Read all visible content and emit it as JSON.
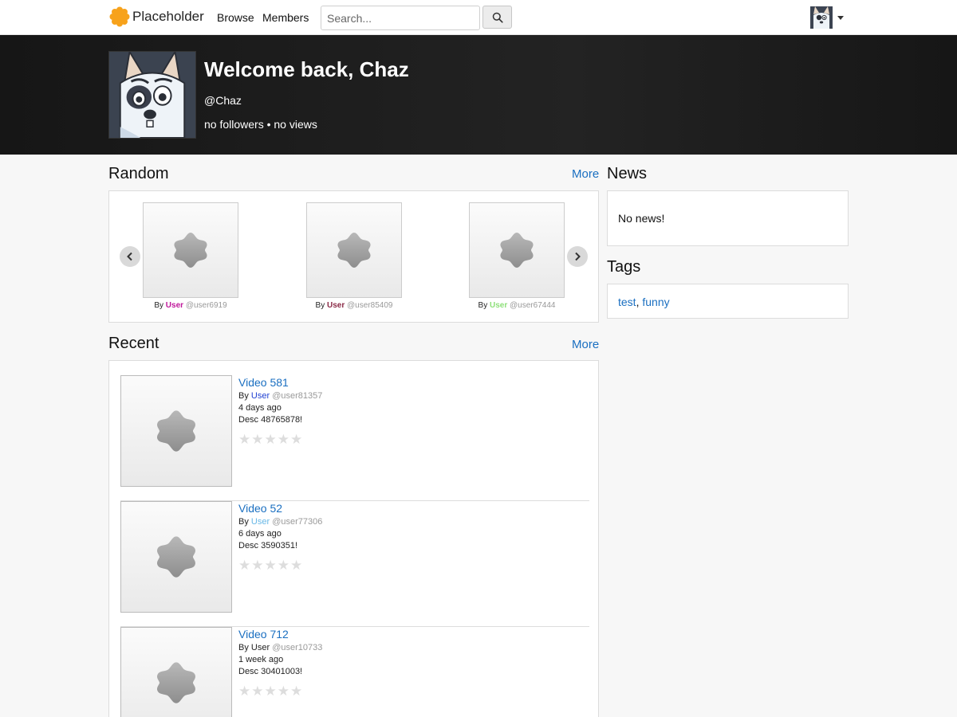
{
  "nav": {
    "brand": "Placeholder",
    "links": [
      "Browse",
      "Members"
    ],
    "search_placeholder": "Search..."
  },
  "banner": {
    "welcome": "Welcome back, Chaz",
    "handle": "@Chaz",
    "stats": "no followers • no views"
  },
  "random": {
    "title": "Random",
    "more": "More",
    "items": [
      {
        "by": "By",
        "user": "User",
        "user_color": "#c0189b",
        "handle": "@user6919"
      },
      {
        "by": "By",
        "user": "User",
        "user_color": "#8a2a46",
        "handle": "@user85409"
      },
      {
        "by": "By",
        "user": "User",
        "user_color": "#8ee07a",
        "handle": "@user67444"
      }
    ]
  },
  "recent": {
    "title": "Recent",
    "more": "More",
    "items": [
      {
        "title": "Video 581",
        "by": "By",
        "user": "User",
        "user_color": "#1f3fd1",
        "handle": "@user81357",
        "time": "4 days ago",
        "desc": "Desc 48765878!",
        "rating": 0
      },
      {
        "title": "Video 52",
        "by": "By",
        "user": "User",
        "user_color": "#67b7e6",
        "handle": "@user77306",
        "time": "6 days ago",
        "desc": "Desc 3590351!",
        "rating": 0
      },
      {
        "title": "Video 712",
        "by": "By",
        "user": "User",
        "user_color": "#222222",
        "handle": "@user10733",
        "time": "1 week ago",
        "desc": "Desc 30401003!",
        "rating": 0
      }
    ]
  },
  "news": {
    "title": "News",
    "empty": "No news!"
  },
  "tags": {
    "title": "Tags",
    "items": [
      "test",
      "funny"
    ],
    "separator": ", "
  },
  "colors": {
    "link": "#1a6fc1",
    "brand": "#f7a21b",
    "banner": "#1b1b1b"
  }
}
